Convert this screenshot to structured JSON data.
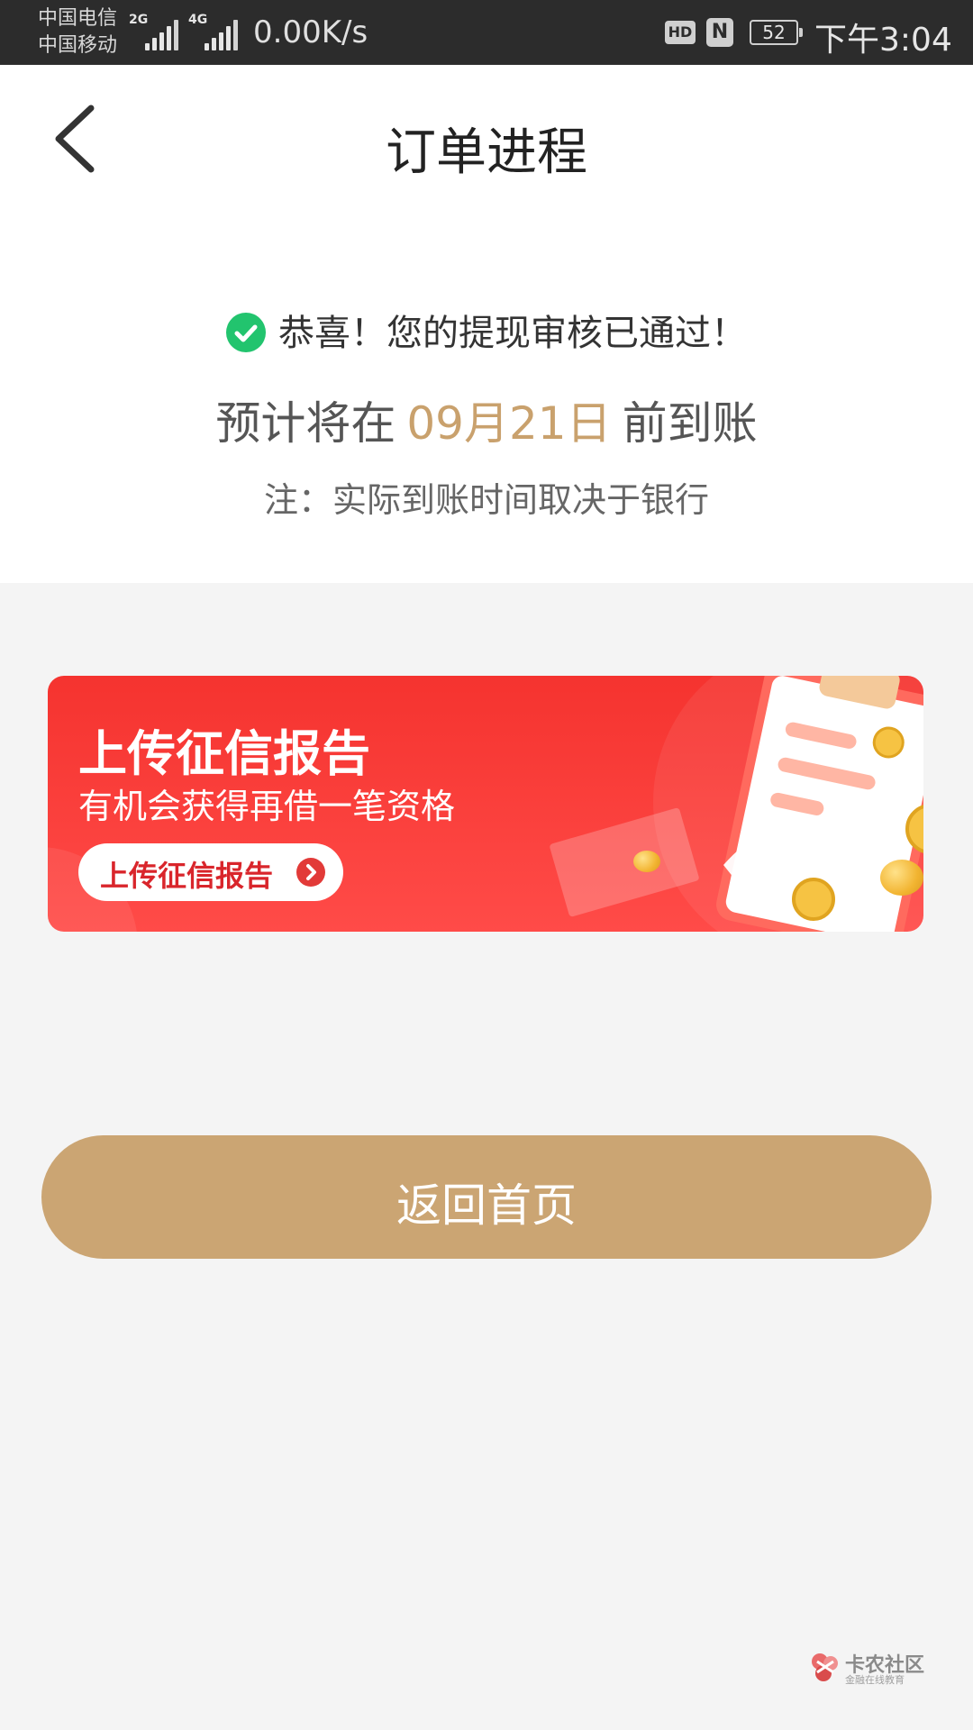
{
  "status_bar": {
    "carrier1": "中国电信",
    "carrier2": "中国移动",
    "net1": "2G",
    "net2": "4G",
    "speed": "0.00K/s",
    "hd": "HD",
    "nfc": "N",
    "battery": "52",
    "time": "下午3:04"
  },
  "header": {
    "back_icon": "chevron-left-icon",
    "title": "订单进程"
  },
  "status": {
    "icon": "check-circle-icon",
    "icon_color": "#22c46e",
    "message": "恭喜！您的提现审核已通过！",
    "eta_prefix": "预计将在",
    "eta_date": "09月21日",
    "eta_suffix": "前到账",
    "eta_color": "#c9a16d",
    "note": "注：实际到账时间取决于银行"
  },
  "banner": {
    "title": "上传征信报告",
    "subtitle": "有机会获得再借一笔资格",
    "button_label": "上传征信报告",
    "button_icon": "chevron-right-circle-icon",
    "colors": {
      "background": "#f5332f",
      "button_text": "#d9252b"
    }
  },
  "actions": {
    "home_label": "返回首页",
    "home_color": "#cba573"
  },
  "watermark": {
    "name": "卡农社区",
    "tagline": "金融在线教育"
  }
}
